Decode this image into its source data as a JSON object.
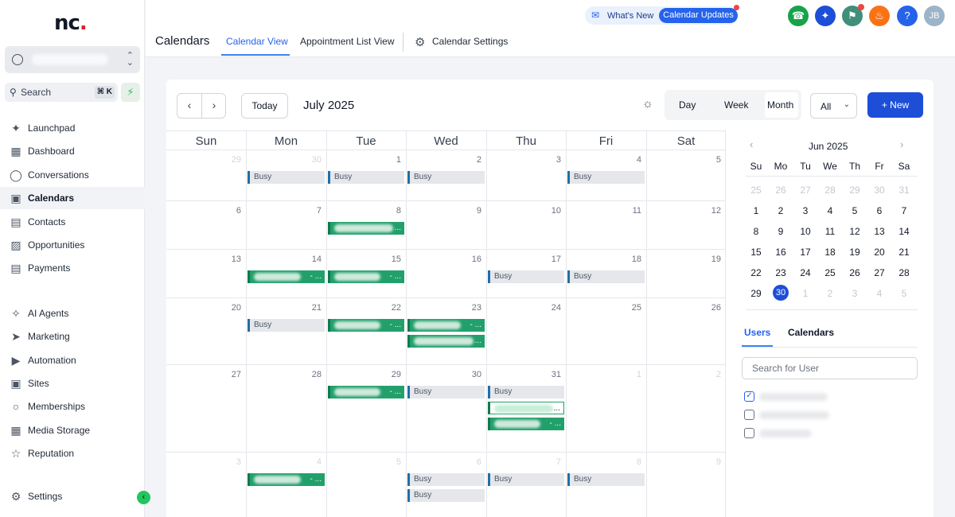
{
  "sidebar": {
    "logo_text": "nc",
    "search": {
      "label": "Search",
      "shortcut": "⌘ K"
    },
    "items": [
      {
        "id": "launchpad",
        "label": "Launchpad",
        "icon": "rocket-icon",
        "active": false
      },
      {
        "id": "dashboard",
        "label": "Dashboard",
        "icon": "grid-icon",
        "active": false
      },
      {
        "id": "conversations",
        "label": "Conversations",
        "icon": "chat-icon",
        "active": false
      },
      {
        "id": "calendars",
        "label": "Calendars",
        "icon": "calendar-icon",
        "active": true
      },
      {
        "id": "contacts",
        "label": "Contacts",
        "icon": "contacts-icon",
        "active": false
      },
      {
        "id": "opportunities",
        "label": "Opportunities",
        "icon": "funnel-icon",
        "active": false
      },
      {
        "id": "payments",
        "label": "Payments",
        "icon": "receipt-icon",
        "active": false
      },
      {
        "id": "ai-agents",
        "label": "AI Agents",
        "icon": "sparkle-icon",
        "active": false
      },
      {
        "id": "marketing",
        "label": "Marketing",
        "icon": "send-icon",
        "active": false
      },
      {
        "id": "automation",
        "label": "Automation",
        "icon": "automation-icon",
        "active": false
      },
      {
        "id": "sites",
        "label": "Sites",
        "icon": "sites-icon",
        "active": false
      },
      {
        "id": "memberships",
        "label": "Memberships",
        "icon": "membership-icon",
        "active": false
      },
      {
        "id": "media-storage",
        "label": "Media Storage",
        "icon": "image-icon",
        "active": false
      },
      {
        "id": "reputation",
        "label": "Reputation",
        "icon": "star-icon",
        "active": false
      }
    ],
    "settings_label": "Settings"
  },
  "header": {
    "title": "Calendars",
    "tabs": [
      {
        "label": "Calendar View",
        "active": true
      },
      {
        "label": "Appointment List View",
        "active": false
      },
      {
        "label": "Calendar Settings",
        "active": false
      }
    ],
    "whats_new": {
      "label": "What's New",
      "pill": "Calendar Updates"
    },
    "user_initials": "JB",
    "help_glyph": "?"
  },
  "calendar": {
    "today_label": "Today",
    "month_label": "July 2025",
    "view_options": [
      "Day",
      "Week",
      "Month"
    ],
    "active_view": "Month",
    "filter_value": "All",
    "new_label": "+ New",
    "weekdays": [
      "Sun",
      "Mon",
      "Tue",
      "Wed",
      "Thu",
      "Fri",
      "Sat"
    ],
    "weeks": [
      [
        {
          "d": "29",
          "cur": false
        },
        {
          "d": "30",
          "cur": false
        },
        {
          "d": "1",
          "cur": true
        },
        {
          "d": "2",
          "cur": true
        },
        {
          "d": "3",
          "cur": true
        },
        {
          "d": "4",
          "cur": true
        },
        {
          "d": "5",
          "cur": true
        }
      ],
      [
        {
          "d": "6",
          "cur": true
        },
        {
          "d": "7",
          "cur": true
        },
        {
          "d": "8",
          "cur": true
        },
        {
          "d": "9",
          "cur": true
        },
        {
          "d": "10",
          "cur": true
        },
        {
          "d": "11",
          "cur": true
        },
        {
          "d": "12",
          "cur": true
        }
      ],
      [
        {
          "d": "13",
          "cur": true
        },
        {
          "d": "14",
          "cur": true
        },
        {
          "d": "15",
          "cur": true
        },
        {
          "d": "16",
          "cur": true
        },
        {
          "d": "17",
          "cur": true
        },
        {
          "d": "18",
          "cur": true
        },
        {
          "d": "19",
          "cur": true
        }
      ],
      [
        {
          "d": "20",
          "cur": true
        },
        {
          "d": "21",
          "cur": true
        },
        {
          "d": "22",
          "cur": true
        },
        {
          "d": "23",
          "cur": true
        },
        {
          "d": "24",
          "cur": true
        },
        {
          "d": "25",
          "cur": true
        },
        {
          "d": "26",
          "cur": true
        }
      ],
      [
        {
          "d": "27",
          "cur": true
        },
        {
          "d": "28",
          "cur": true
        },
        {
          "d": "29",
          "cur": true
        },
        {
          "d": "30",
          "cur": true
        },
        {
          "d": "31",
          "cur": true
        },
        {
          "d": "1",
          "cur": false
        },
        {
          "d": "2",
          "cur": false
        }
      ],
      [
        {
          "d": "3",
          "cur": false
        },
        {
          "d": "4",
          "cur": false
        },
        {
          "d": "5",
          "cur": false
        },
        {
          "d": "6",
          "cur": false
        },
        {
          "d": "7",
          "cur": false
        },
        {
          "d": "8",
          "cur": false
        },
        {
          "d": "9",
          "cur": false
        }
      ]
    ],
    "events": [
      {
        "week": 0,
        "day": 1,
        "slot": 0,
        "type": "busy",
        "label": "Busy"
      },
      {
        "week": 0,
        "day": 2,
        "slot": 0,
        "type": "busy",
        "label": "Busy"
      },
      {
        "week": 0,
        "day": 3,
        "slot": 0,
        "type": "busy",
        "label": "Busy"
      },
      {
        "week": 0,
        "day": 5,
        "slot": 0,
        "type": "busy",
        "label": "Busy"
      },
      {
        "week": 1,
        "day": 2,
        "slot": 0,
        "type": "appt",
        "label": "..."
      },
      {
        "week": 2,
        "day": 1,
        "slot": 0,
        "type": "appt",
        "label": "- ..."
      },
      {
        "week": 2,
        "day": 2,
        "slot": 0,
        "type": "appt",
        "label": "- ..."
      },
      {
        "week": 2,
        "day": 4,
        "slot": 0,
        "type": "busy",
        "label": "Busy"
      },
      {
        "week": 2,
        "day": 5,
        "slot": 0,
        "type": "busy",
        "label": "Busy"
      },
      {
        "week": 3,
        "day": 1,
        "slot": 0,
        "type": "busy",
        "label": "Busy"
      },
      {
        "week": 3,
        "day": 2,
        "slot": 0,
        "type": "appt",
        "label": "- ..."
      },
      {
        "week": 3,
        "day": 3,
        "slot": 0,
        "type": "appt",
        "label": "- ..."
      },
      {
        "week": 3,
        "day": 3,
        "slot": 1,
        "type": "appt",
        "label": "..."
      },
      {
        "week": 4,
        "day": 2,
        "slot": 0,
        "type": "appt",
        "label": "- ..."
      },
      {
        "week": 4,
        "day": 3,
        "slot": 0,
        "type": "busy",
        "label": "Busy"
      },
      {
        "week": 4,
        "day": 4,
        "slot": 0,
        "type": "busy",
        "label": "Busy"
      },
      {
        "week": 4,
        "day": 4,
        "slot": 1,
        "type": "appt-outline",
        "label": "..."
      },
      {
        "week": 4,
        "day": 4,
        "slot": 2,
        "type": "appt",
        "label": "- ..."
      },
      {
        "week": 5,
        "day": 1,
        "slot": 0,
        "type": "appt",
        "label": "- ..."
      },
      {
        "week": 5,
        "day": 3,
        "slot": 0,
        "type": "busy",
        "label": "Busy"
      },
      {
        "week": 5,
        "day": 3,
        "slot": 1,
        "type": "busy",
        "label": "Busy"
      },
      {
        "week": 5,
        "day": 4,
        "slot": 0,
        "type": "busy",
        "label": "Busy"
      },
      {
        "week": 5,
        "day": 5,
        "slot": 0,
        "type": "busy",
        "label": "Busy"
      }
    ]
  },
  "mini_calendar": {
    "title": "Jun 2025",
    "weekdays": [
      "Su",
      "Mo",
      "Tu",
      "We",
      "Th",
      "Fr",
      "Sa"
    ],
    "weeks": [
      [
        {
          "d": "25",
          "cur": false
        },
        {
          "d": "26",
          "cur": false
        },
        {
          "d": "27",
          "cur": false
        },
        {
          "d": "28",
          "cur": false
        },
        {
          "d": "29",
          "cur": false
        },
        {
          "d": "30",
          "cur": false
        },
        {
          "d": "31",
          "cur": false
        }
      ],
      [
        {
          "d": "1",
          "cur": true
        },
        {
          "d": "2",
          "cur": true
        },
        {
          "d": "3",
          "cur": true
        },
        {
          "d": "4",
          "cur": true
        },
        {
          "d": "5",
          "cur": true
        },
        {
          "d": "6",
          "cur": true
        },
        {
          "d": "7",
          "cur": true
        }
      ],
      [
        {
          "d": "8",
          "cur": true
        },
        {
          "d": "9",
          "cur": true
        },
        {
          "d": "10",
          "cur": true
        },
        {
          "d": "11",
          "cur": true
        },
        {
          "d": "12",
          "cur": true
        },
        {
          "d": "13",
          "cur": true
        },
        {
          "d": "14",
          "cur": true
        }
      ],
      [
        {
          "d": "15",
          "cur": true
        },
        {
          "d": "16",
          "cur": true
        },
        {
          "d": "17",
          "cur": true
        },
        {
          "d": "18",
          "cur": true
        },
        {
          "d": "19",
          "cur": true
        },
        {
          "d": "20",
          "cur": true
        },
        {
          "d": "21",
          "cur": true
        }
      ],
      [
        {
          "d": "22",
          "cur": true
        },
        {
          "d": "23",
          "cur": true
        },
        {
          "d": "24",
          "cur": true
        },
        {
          "d": "25",
          "cur": true
        },
        {
          "d": "26",
          "cur": true
        },
        {
          "d": "27",
          "cur": true
        },
        {
          "d": "28",
          "cur": true
        }
      ],
      [
        {
          "d": "29",
          "cur": true
        },
        {
          "d": "30",
          "cur": true,
          "selected": true
        },
        {
          "d": "1",
          "cur": false
        },
        {
          "d": "2",
          "cur": false
        },
        {
          "d": "3",
          "cur": false
        },
        {
          "d": "4",
          "cur": false
        },
        {
          "d": "5",
          "cur": false
        }
      ]
    ]
  },
  "side_panel": {
    "tabs": [
      {
        "label": "Users",
        "active": true
      },
      {
        "label": "Calendars",
        "active": false
      }
    ],
    "user_search_placeholder": "Search for User",
    "users": [
      {
        "checked": true
      },
      {
        "checked": false
      },
      {
        "checked": false
      }
    ]
  },
  "colors": {
    "accent": "#2563eb",
    "appointment": "#22a06b",
    "busy_bg": "#e5e7eb",
    "event_border": "#1e6fa8",
    "phone_btn": "#16a34a",
    "ai_btn": "#1d4ed8",
    "announce_btn": "#3f8f7a",
    "bell_btn": "#f97316",
    "help_btn": "#2563eb",
    "avatar_btn": "#9db3c8"
  }
}
